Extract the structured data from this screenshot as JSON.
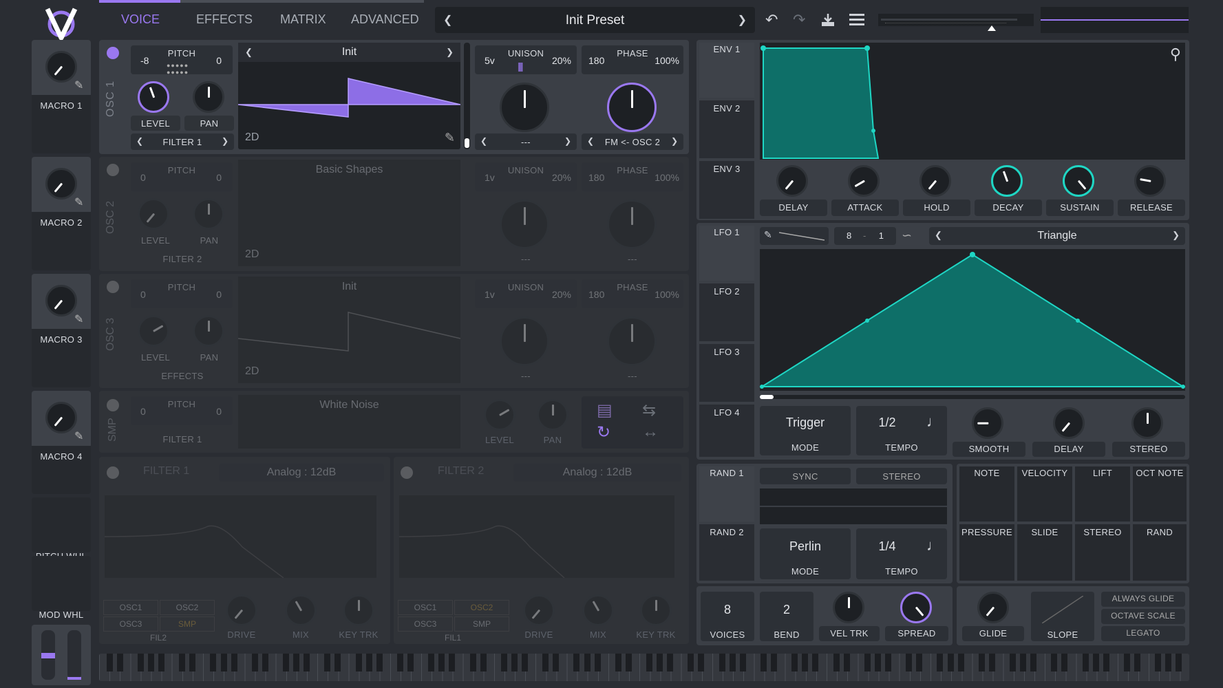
{
  "header": {
    "tabs": [
      "VOICE",
      "EFFECTS",
      "MATRIX",
      "ADVANCED"
    ],
    "active_tab": "VOICE",
    "preset": "Init Preset",
    "accent": "#a07cf5"
  },
  "macros": [
    "MACRO 1",
    "MACRO 2",
    "MACRO 3",
    "MACRO 4"
  ],
  "wheels": [
    "PITCH WHL",
    "MOD WHL"
  ],
  "osc": [
    {
      "name": "OSC 1",
      "pitch_label": "PITCH",
      "pitch_left": "-8",
      "pitch_right": "0",
      "wave": "Init",
      "wave_mode": "2D",
      "level": "LEVEL",
      "pan": "PAN",
      "route": "FILTER 1",
      "unison_voices": "5v",
      "unison_label": "UNISON",
      "unison_pct": "20%",
      "phase_val": "180",
      "phase_label": "PHASE",
      "phase_pct": "100%",
      "unison_sel": "---",
      "phase_sel": "FM <- OSC 2"
    },
    {
      "name": "OSC 2",
      "pitch_label": "PITCH",
      "pitch_left": "0",
      "pitch_right": "0",
      "wave": "Basic Shapes",
      "wave_mode": "2D",
      "level": "LEVEL",
      "pan": "PAN",
      "route": "FILTER 2",
      "unison_voices": "1v",
      "unison_label": "UNISON",
      "unison_pct": "20%",
      "phase_val": "180",
      "phase_label": "PHASE",
      "phase_pct": "100%",
      "unison_sel": "---",
      "phase_sel": "---"
    },
    {
      "name": "OSC 3",
      "pitch_label": "PITCH",
      "pitch_left": "0",
      "pitch_right": "0",
      "wave": "Init",
      "wave_mode": "2D",
      "level": "LEVEL",
      "pan": "PAN",
      "route": "EFFECTS",
      "unison_voices": "1v",
      "unison_label": "UNISON",
      "unison_pct": "20%",
      "phase_val": "180",
      "phase_label": "PHASE",
      "phase_pct": "100%",
      "unison_sel": "---",
      "phase_sel": "---"
    }
  ],
  "smp": {
    "name": "SMP",
    "pitch_label": "PITCH",
    "pitch_left": "0",
    "pitch_right": "0",
    "sample": "White Noise",
    "route": "FILTER 1",
    "level": "LEVEL",
    "pan": "PAN"
  },
  "filters": [
    {
      "name": "FILTER 1",
      "type": "Analog : 12dB",
      "srcs": [
        "OSC1",
        "OSC2",
        "OSC3",
        "SMP"
      ],
      "active_src": "",
      "fil": "FIL2",
      "knobs": [
        "DRIVE",
        "MIX",
        "KEY TRK"
      ]
    },
    {
      "name": "FILTER 2",
      "type": "Analog : 12dB",
      "srcs": [
        "OSC1",
        "OSC2",
        "OSC3",
        "SMP"
      ],
      "active_src": "OSC2",
      "fil": "FIL1",
      "knobs": [
        "DRIVE",
        "MIX",
        "KEY TRK"
      ]
    }
  ],
  "envs": [
    "ENV 1",
    "ENV 2",
    "ENV 3"
  ],
  "env_knobs": [
    "DELAY",
    "ATTACK",
    "HOLD",
    "DECAY",
    "SUSTAIN",
    "RELEASE"
  ],
  "lfos": [
    "LFO 1",
    "LFO 2",
    "LFO 3",
    "LFO 4"
  ],
  "lfo": {
    "grid_a": "8",
    "grid_dash": "-",
    "grid_b": "1",
    "shape": "Triangle",
    "mode_val": "Trigger",
    "mode_lbl": "MODE",
    "tempo_val": "1/2",
    "tempo_lbl": "TEMPO",
    "knobs": [
      "SMOOTH",
      "DELAY",
      "STEREO"
    ]
  },
  "rands": [
    "RAND 1",
    "RAND 2"
  ],
  "rand": {
    "sync": "SYNC",
    "stereo": "STEREO",
    "mode_val": "Perlin",
    "mode_lbl": "MODE",
    "tempo_val": "1/4",
    "tempo_lbl": "TEMPO"
  },
  "mod_sources": [
    "NOTE",
    "VELOCITY",
    "LIFT",
    "OCT NOTE",
    "PRESSURE",
    "SLIDE",
    "STEREO",
    "RAND"
  ],
  "voice": {
    "voices": "8",
    "voices_lbl": "VOICES",
    "bend": "2",
    "bend_lbl": "BEND",
    "veltrk": "VEL TRK",
    "spread": "SPREAD",
    "glide": "GLIDE",
    "slope": "SLOPE",
    "opts": [
      "ALWAYS GLIDE",
      "OCTAVE SCALE",
      "LEGATO"
    ]
  },
  "colors": {
    "teal": "#1fd6c4",
    "purple": "#9a78f0"
  }
}
